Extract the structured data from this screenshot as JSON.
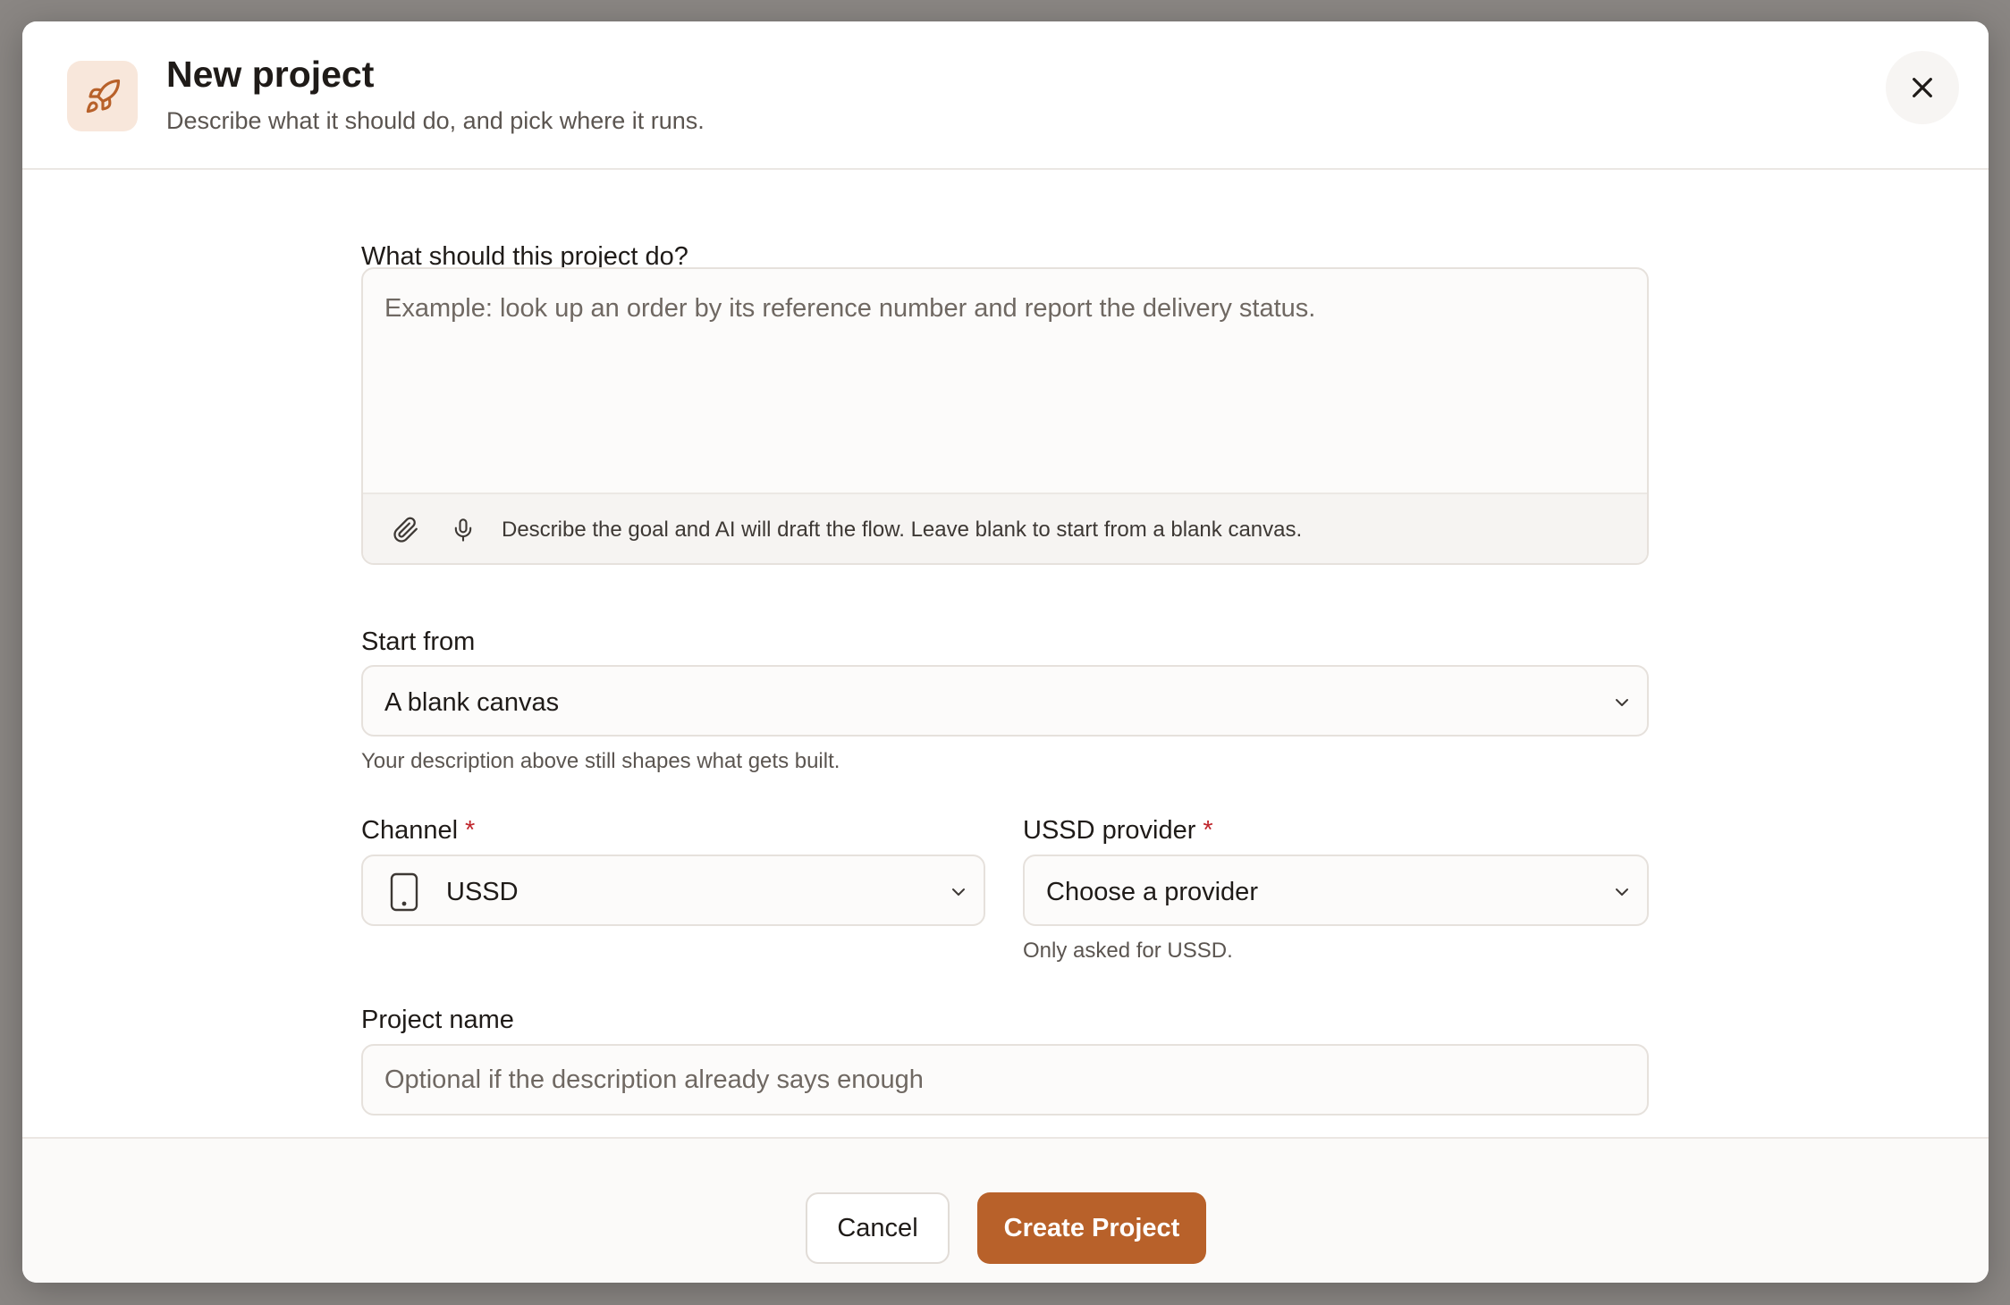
{
  "header": {
    "icon": "rocket-icon",
    "title": "New project",
    "subtitle": "Describe what it should do, and pick where it runs."
  },
  "description": {
    "label": "What should this project do?",
    "placeholder": "Example: look up an order by its reference number and report the delivery status.",
    "value": "",
    "attach_icon": "paperclip-icon",
    "mic_icon": "microphone-icon",
    "hint": "Describe the goal and AI will draft the flow. Leave blank to start from a blank canvas."
  },
  "start_from": {
    "label": "Start from",
    "value": "A blank canvas",
    "help": "Your description above still shapes what gets built."
  },
  "channel": {
    "label": "Channel",
    "required_mark": "*",
    "icon": "phone-icon",
    "value": "USSD"
  },
  "ussd_provider": {
    "label": "USSD provider",
    "required_mark": "*",
    "value": "Choose a provider",
    "help": "Only asked for USSD."
  },
  "project_name": {
    "label": "Project name",
    "placeholder": "Optional if the description already says enough",
    "value": ""
  },
  "footer": {
    "cancel_label": "Cancel",
    "create_label": "Create Project"
  },
  "colors": {
    "accent": "#b8612a",
    "accent_soft": "#f8e7db",
    "required": "#c0262d",
    "backdrop": "#8a8683"
  }
}
